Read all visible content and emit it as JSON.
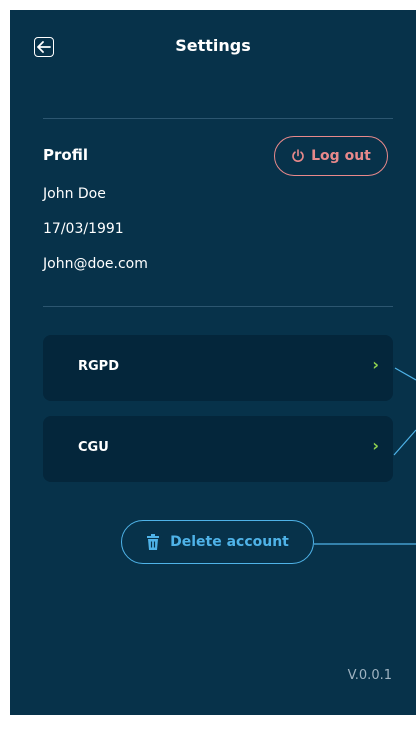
{
  "header": {
    "title": "Settings",
    "back_icon": "arrow-left-icon"
  },
  "profile": {
    "heading": "Profil",
    "name": "John Doe",
    "birthdate": "17/03/1991",
    "email": "John@doe.com",
    "logout_label": "Log out",
    "logout_icon": "power-icon"
  },
  "menu": {
    "items": [
      {
        "label": "RGPD",
        "icon": "chevron-right-icon"
      },
      {
        "label": "CGU",
        "icon": "chevron-right-icon"
      }
    ]
  },
  "delete_account": {
    "label": "Delete account",
    "icon": "trash-icon"
  },
  "footer": {
    "version": "V.0.0.1"
  },
  "colors": {
    "background": "#07324a",
    "card": "#04263b",
    "logout": "#e8898b",
    "delete": "#4fb3e8",
    "chevron": "#8fd14f"
  }
}
